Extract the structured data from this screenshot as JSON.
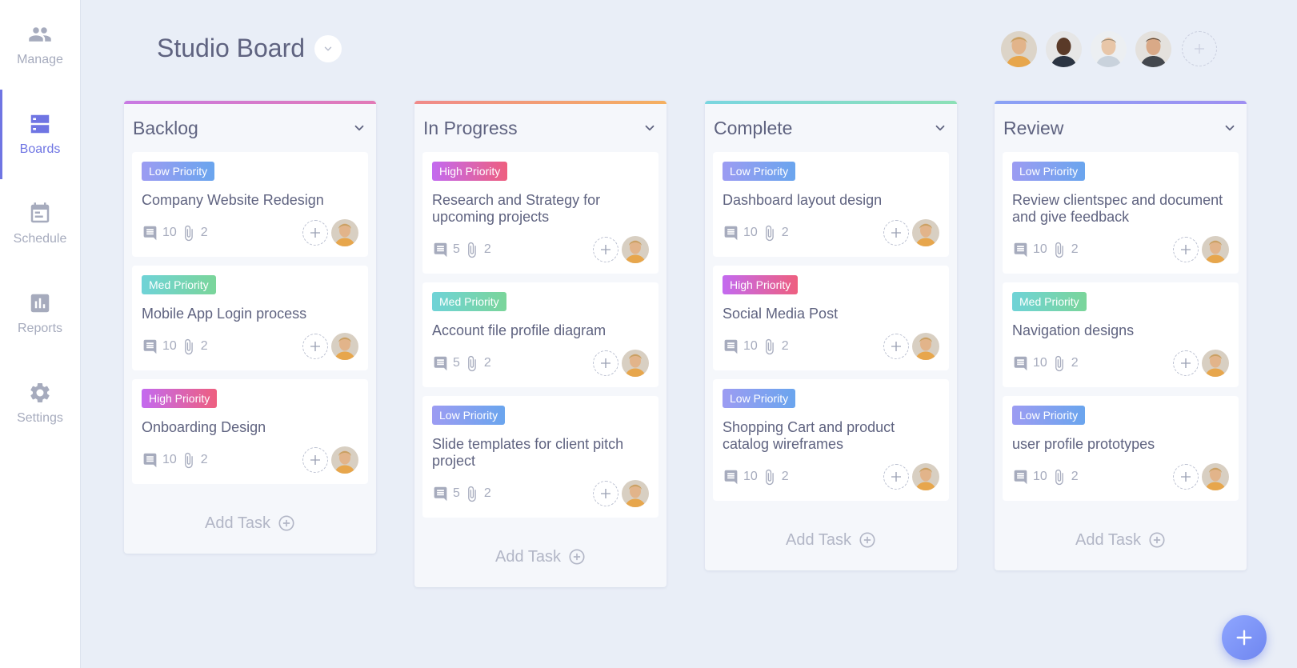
{
  "sidebar": {
    "items": [
      {
        "label": "Manage",
        "icon": "people-icon"
      },
      {
        "label": "Boards",
        "icon": "boards-icon",
        "active": true
      },
      {
        "label": "Schedule",
        "icon": "calendar-icon"
      },
      {
        "label": "Reports",
        "icon": "bar-chart-icon"
      },
      {
        "label": "Settings",
        "icon": "gear-icon"
      }
    ]
  },
  "header": {
    "title": "Studio Board",
    "member_count": 4
  },
  "colors": {
    "accent": "#6f75e3",
    "low": "#8e9bf2",
    "med": "#6fd3c4",
    "high": "#e066a8",
    "backlog": "#c87ae3",
    "in_progress": "#f39a6b",
    "complete": "#7cd8d3",
    "review": "#8aa2f5"
  },
  "add_task_label": "Add Task",
  "columns": [
    {
      "title": "Backlog",
      "color_key": "backlog",
      "cards": [
        {
          "priority": "Low Priority",
          "level": "low",
          "title": "Company Website Redesign",
          "comments": "10",
          "attachments": "2"
        },
        {
          "priority": "Med Priority",
          "level": "med",
          "title": "Mobile App Login process",
          "comments": "10",
          "attachments": "2"
        },
        {
          "priority": "High Priority",
          "level": "high",
          "title": "Onboarding Design",
          "comments": "10",
          "attachments": "2"
        }
      ]
    },
    {
      "title": "In Progress",
      "color_key": "in_progress",
      "cards": [
        {
          "priority": "High Priority",
          "level": "high",
          "title": "Research and Strategy for upcoming projects",
          "comments": "5",
          "attachments": "2"
        },
        {
          "priority": "Med Priority",
          "level": "med",
          "title": "Account file profile diagram",
          "comments": "5",
          "attachments": "2"
        },
        {
          "priority": "Low Priority",
          "level": "low",
          "title": "Slide templates for client pitch project",
          "comments": "5",
          "attachments": "2"
        }
      ]
    },
    {
      "title": "Complete",
      "color_key": "complete",
      "cards": [
        {
          "priority": "Low Priority",
          "level": "low",
          "title": "Dashboard layout design",
          "comments": "10",
          "attachments": "2"
        },
        {
          "priority": "High Priority",
          "level": "high",
          "title": "Social Media Post",
          "comments": "10",
          "attachments": "2"
        },
        {
          "priority": "Low Priority",
          "level": "low",
          "title": "Shopping Cart and product catalog wireframes",
          "comments": "10",
          "attachments": "2"
        }
      ]
    },
    {
      "title": "Review",
      "color_key": "review",
      "cards": [
        {
          "priority": "Low Priority",
          "level": "low",
          "title": "Review clientspec and document and give feedback",
          "comments": "10",
          "attachments": "2"
        },
        {
          "priority": "Med Priority",
          "level": "med",
          "title": "Navigation designs",
          "comments": "10",
          "attachments": "2"
        },
        {
          "priority": "Low Priority",
          "level": "low",
          "title": "user profile prototypes",
          "comments": "10",
          "attachments": "2"
        }
      ]
    }
  ]
}
